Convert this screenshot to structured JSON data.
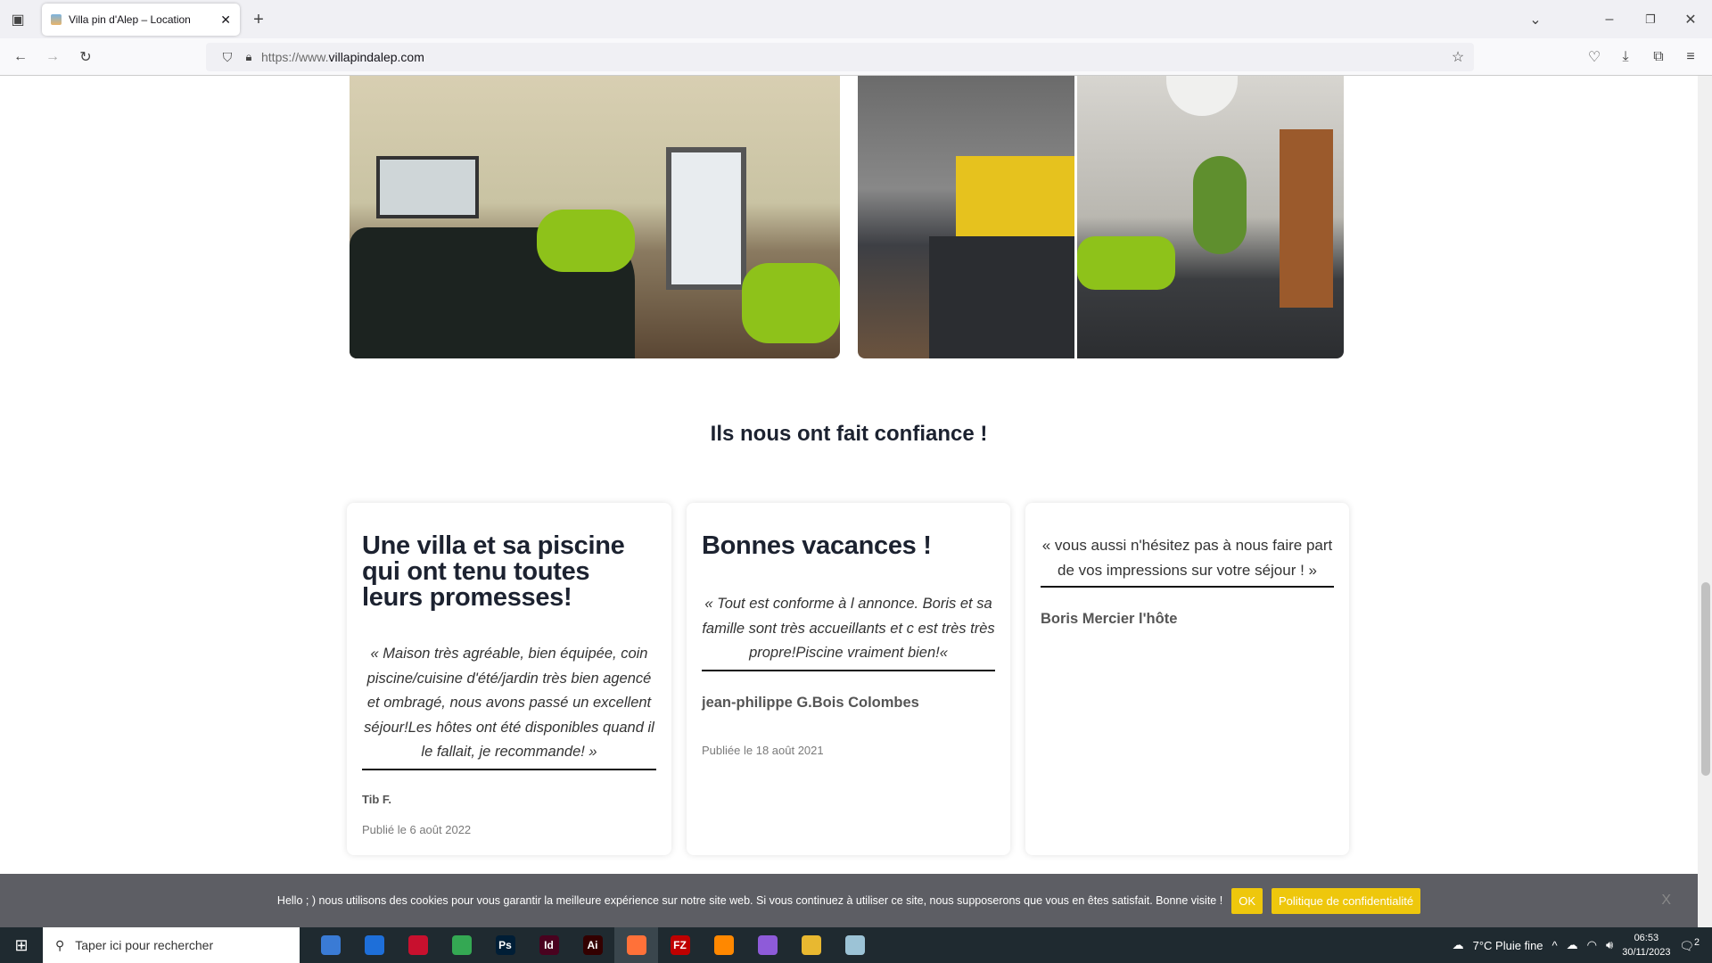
{
  "browser": {
    "tab_title": "Villa pin d'Alep – Location",
    "url_prefix": "https://www.",
    "url_domain": "villapindalep.com"
  },
  "section": {
    "title": "Ils nous ont fait confiance !"
  },
  "testimonials": [
    {
      "title": "Une villa et sa piscine qui ont tenu toutes leurs promesses!",
      "quote": "« Maison très agréable, bien équipée, coin piscine/cuisine d'été/jardin très bien agencé et ombragé, nous avons passé un excellent séjour!Les hôtes ont été disponibles quand il le fallait, je recommande! »",
      "author": "Tib F.",
      "date": "Publié le 6 août 2022"
    },
    {
      "title": "Bonnes vacances !",
      "quote": "« Tout est conforme à l annonce. Boris et sa famille sont très accueillants et c est très très propre!Piscine vraiment bien!«",
      "author": "jean-philippe G.Bois Colombes",
      "date": "Publiée le 18 août 2021"
    },
    {
      "quote": "« vous aussi n'hésitez pas à nous faire part de vos impressions sur votre séjour ! »",
      "author": "Boris Mercier l'hôte"
    }
  ],
  "cookie": {
    "text": "Hello ; ) nous utilisons des cookies pour vous garantir la meilleure expérience sur notre site web. Si vous continuez à utiliser ce site, nous supposerons que vous en êtes satisfait. Bonne visite !",
    "ok": "OK",
    "policy": "Politique de confidentialité",
    "close": "X"
  },
  "taskbar": {
    "search_placeholder": "Taper ici pour rechercher",
    "apps": [
      {
        "label": "",
        "color": "#3a7bd5"
      },
      {
        "label": "",
        "color": "#1e6fd9"
      },
      {
        "label": "",
        "color": "#c8102e"
      },
      {
        "label": "",
        "color": "#34a853"
      },
      {
        "label": "Ps",
        "color": "#001e36"
      },
      {
        "label": "Id",
        "color": "#49021f"
      },
      {
        "label": "Ai",
        "color": "#330000"
      },
      {
        "label": "",
        "color": "#ff7139"
      },
      {
        "label": "FZ",
        "color": "#bf0000"
      },
      {
        "label": "",
        "color": "#ff8800"
      },
      {
        "label": "",
        "color": "#8e5bd9"
      },
      {
        "label": "",
        "color": "#e8b830"
      },
      {
        "label": "",
        "color": "#9cc3d6"
      }
    ],
    "weather": "7°C  Pluie fine",
    "time": "06:53",
    "date": "30/11/2023",
    "notifications": "2"
  }
}
